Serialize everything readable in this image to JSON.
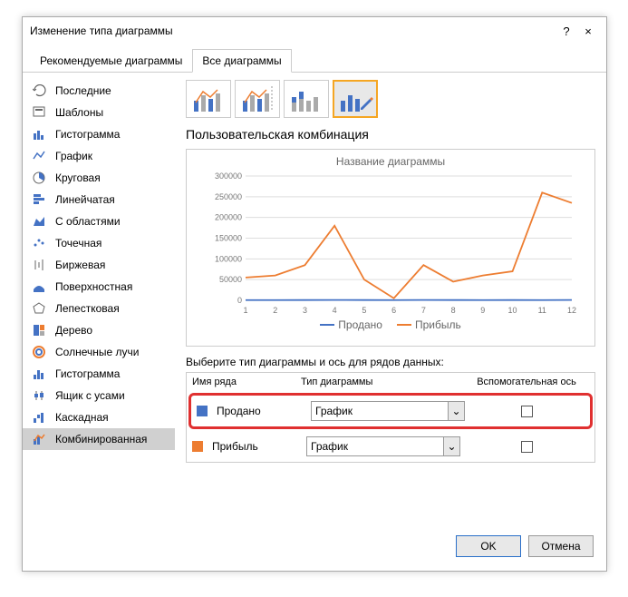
{
  "titlebar": {
    "title": "Изменение типа диаграммы",
    "help": "?",
    "close": "×"
  },
  "tabs": {
    "recommended": "Рекомендуемые диаграммы",
    "all": "Все диаграммы"
  },
  "sidebar": {
    "items": [
      {
        "label": "Последние"
      },
      {
        "label": "Шаблоны"
      },
      {
        "label": "Гистограмма"
      },
      {
        "label": "График"
      },
      {
        "label": "Круговая"
      },
      {
        "label": "Линейчатая"
      },
      {
        "label": "С областями"
      },
      {
        "label": "Точечная"
      },
      {
        "label": "Биржевая"
      },
      {
        "label": "Поверхностная"
      },
      {
        "label": "Лепестковая"
      },
      {
        "label": "Дерево"
      },
      {
        "label": "Солнечные лучи"
      },
      {
        "label": "Гистограмма"
      },
      {
        "label": "Ящик с усами"
      },
      {
        "label": "Каскадная"
      },
      {
        "label": "Комбинированная"
      }
    ]
  },
  "main": {
    "section_title": "Пользовательская комбинация",
    "chart_title": "Название диаграммы",
    "series_prompt": "Выберите тип диаграммы и ось для рядов данных:",
    "headers": {
      "name": "Имя ряда",
      "type": "Тип диаграммы",
      "aux": "Вспомогательная ось"
    },
    "rows": [
      {
        "name": "Продано",
        "type": "График",
        "color": "#4472c4"
      },
      {
        "name": "Прибыль",
        "type": "График",
        "color": "#ed7d31"
      }
    ],
    "legend": {
      "s1": "Продано",
      "s2": "Прибыль"
    }
  },
  "footer": {
    "ok": "OK",
    "cancel": "Отмена"
  },
  "chart_data": {
    "type": "line",
    "title": "Название диаграммы",
    "categories": [
      1,
      2,
      3,
      4,
      5,
      6,
      7,
      8,
      9,
      10,
      11,
      12
    ],
    "y_ticks": [
      0,
      50000,
      100000,
      150000,
      200000,
      250000,
      300000
    ],
    "ylim": [
      0,
      300000
    ],
    "series": [
      {
        "name": "Продано",
        "color": "#4472c4",
        "values": [
          500,
          600,
          700,
          800,
          700,
          600,
          800,
          700,
          500,
          700,
          600,
          800
        ]
      },
      {
        "name": "Прибыль",
        "color": "#ed7d31",
        "values": [
          55000,
          60000,
          85000,
          180000,
          50000,
          5000,
          85000,
          45000,
          60000,
          70000,
          260000,
          235000
        ]
      }
    ]
  }
}
